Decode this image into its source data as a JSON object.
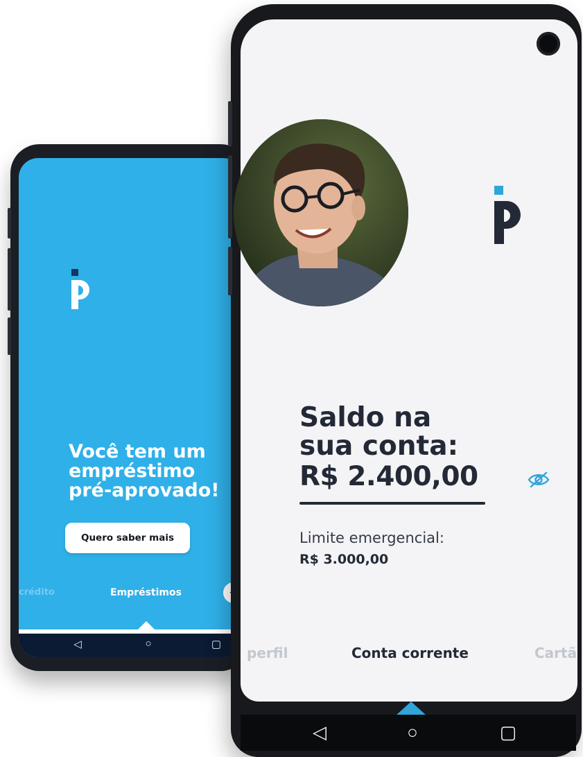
{
  "colors": {
    "brand_blue": "#2FB0E8",
    "dark_text": "#232936",
    "accent": "#2FA5DA"
  },
  "back_phone": {
    "logo_icon": "brand-p-logo-icon",
    "headline_lines": [
      "Você tem um",
      "empréstimo",
      "pré-aprovado!"
    ],
    "cta_label": "Quero saber mais",
    "tabs": {
      "previous": "crédito",
      "active": "Empréstimos",
      "add_icon": "plus-icon"
    },
    "nav": {
      "back": "◁",
      "home": "○",
      "recents": "▢"
    }
  },
  "front_phone": {
    "logo_icon": "brand-p-logo-icon",
    "avatar_icon": "user-avatar",
    "balance": {
      "title_lines": [
        "Saldo na",
        "sua conta:"
      ],
      "amount": "R$ 2.400,00",
      "toggle_icon": "eye-off-icon"
    },
    "limit": {
      "label": "Limite emergencial:",
      "value": "R$ 3.000,00"
    },
    "tabs": {
      "previous": "perfil",
      "active": "Conta corrente",
      "next": "Cartã"
    },
    "nav": {
      "back": "◁",
      "home": "○",
      "recents": "▢"
    }
  }
}
